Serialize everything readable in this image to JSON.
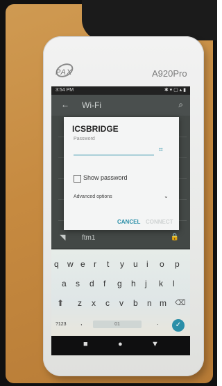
{
  "device": {
    "brand": "PAX",
    "model": "A920Pro"
  },
  "status_bar": {
    "time": "3:54 PM",
    "right": "✱ ▾ ▢ ▴ ▮"
  },
  "app_bar": {
    "title": "Wi-Fi"
  },
  "dialog": {
    "network_name": "ICSBRIDGE",
    "password_label": "Password",
    "show_password_label": "Show password",
    "advanced_options_label": "Advanced options",
    "cancel_label": "CANCEL",
    "connect_label": "CONNECT"
  },
  "network_list": {
    "visible_network": "ftm1"
  },
  "keyboard": {
    "row1": [
      "q",
      "w",
      "e",
      "r",
      "t",
      "y",
      "u",
      "i",
      "o",
      "p"
    ],
    "row2": [
      "a",
      "s",
      "d",
      "f",
      "g",
      "h",
      "j",
      "k",
      "l"
    ],
    "row3": [
      "z",
      "x",
      "c",
      "v",
      "b",
      "n",
      "m"
    ],
    "bottom": [
      "?123",
      ",",
      ".",
      "01"
    ]
  },
  "colors": {
    "accent": "#2b8fa8",
    "table": "#c68a40"
  }
}
